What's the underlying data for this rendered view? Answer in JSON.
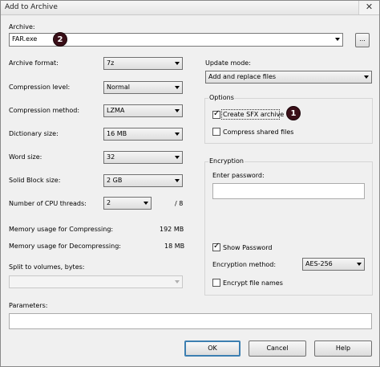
{
  "window": {
    "title": "Add to Archive",
    "close_glyph": "✕"
  },
  "archive": {
    "label": "Archive:",
    "value": "FAR.exe",
    "browse_label": "...",
    "badge": "2"
  },
  "left": {
    "format_label": "Archive format:",
    "format_value": "7z",
    "level_label": "Compression level:",
    "level_value": "Normal",
    "method_label": "Compression method:",
    "method_value": "LZMA",
    "dict_label": "Dictionary size:",
    "dict_value": "16 MB",
    "word_label": "Word size:",
    "word_value": "32",
    "block_label": "Solid Block size:",
    "block_value": "2 GB",
    "threads_label": "Number of CPU threads:",
    "threads_value": "2",
    "threads_max": "/ 8",
    "mem_comp_label": "Memory usage for Compressing:",
    "mem_comp_value": "192 MB",
    "mem_decomp_label": "Memory usage for Decompressing:",
    "mem_decomp_value": "18 MB",
    "split_label": "Split to volumes, bytes:",
    "split_value": ""
  },
  "update": {
    "label": "Update mode:",
    "value": "Add and replace files"
  },
  "options": {
    "group_label": "Options",
    "sfx_label": "Create SFX archive",
    "sfx_checked": true,
    "sfx_badge": "1",
    "shared_label": "Compress shared files",
    "shared_checked": false
  },
  "encryption": {
    "group_label": "Encryption",
    "password_label": "Enter password:",
    "password_value": "",
    "show_password_label": "Show Password",
    "show_password_checked": true,
    "method_label": "Encryption method:",
    "method_value": "AES-256",
    "names_label": "Encrypt file names",
    "names_checked": false
  },
  "parameters": {
    "label": "Parameters:",
    "value": ""
  },
  "buttons": {
    "ok": "OK",
    "cancel": "Cancel",
    "help": "Help"
  }
}
